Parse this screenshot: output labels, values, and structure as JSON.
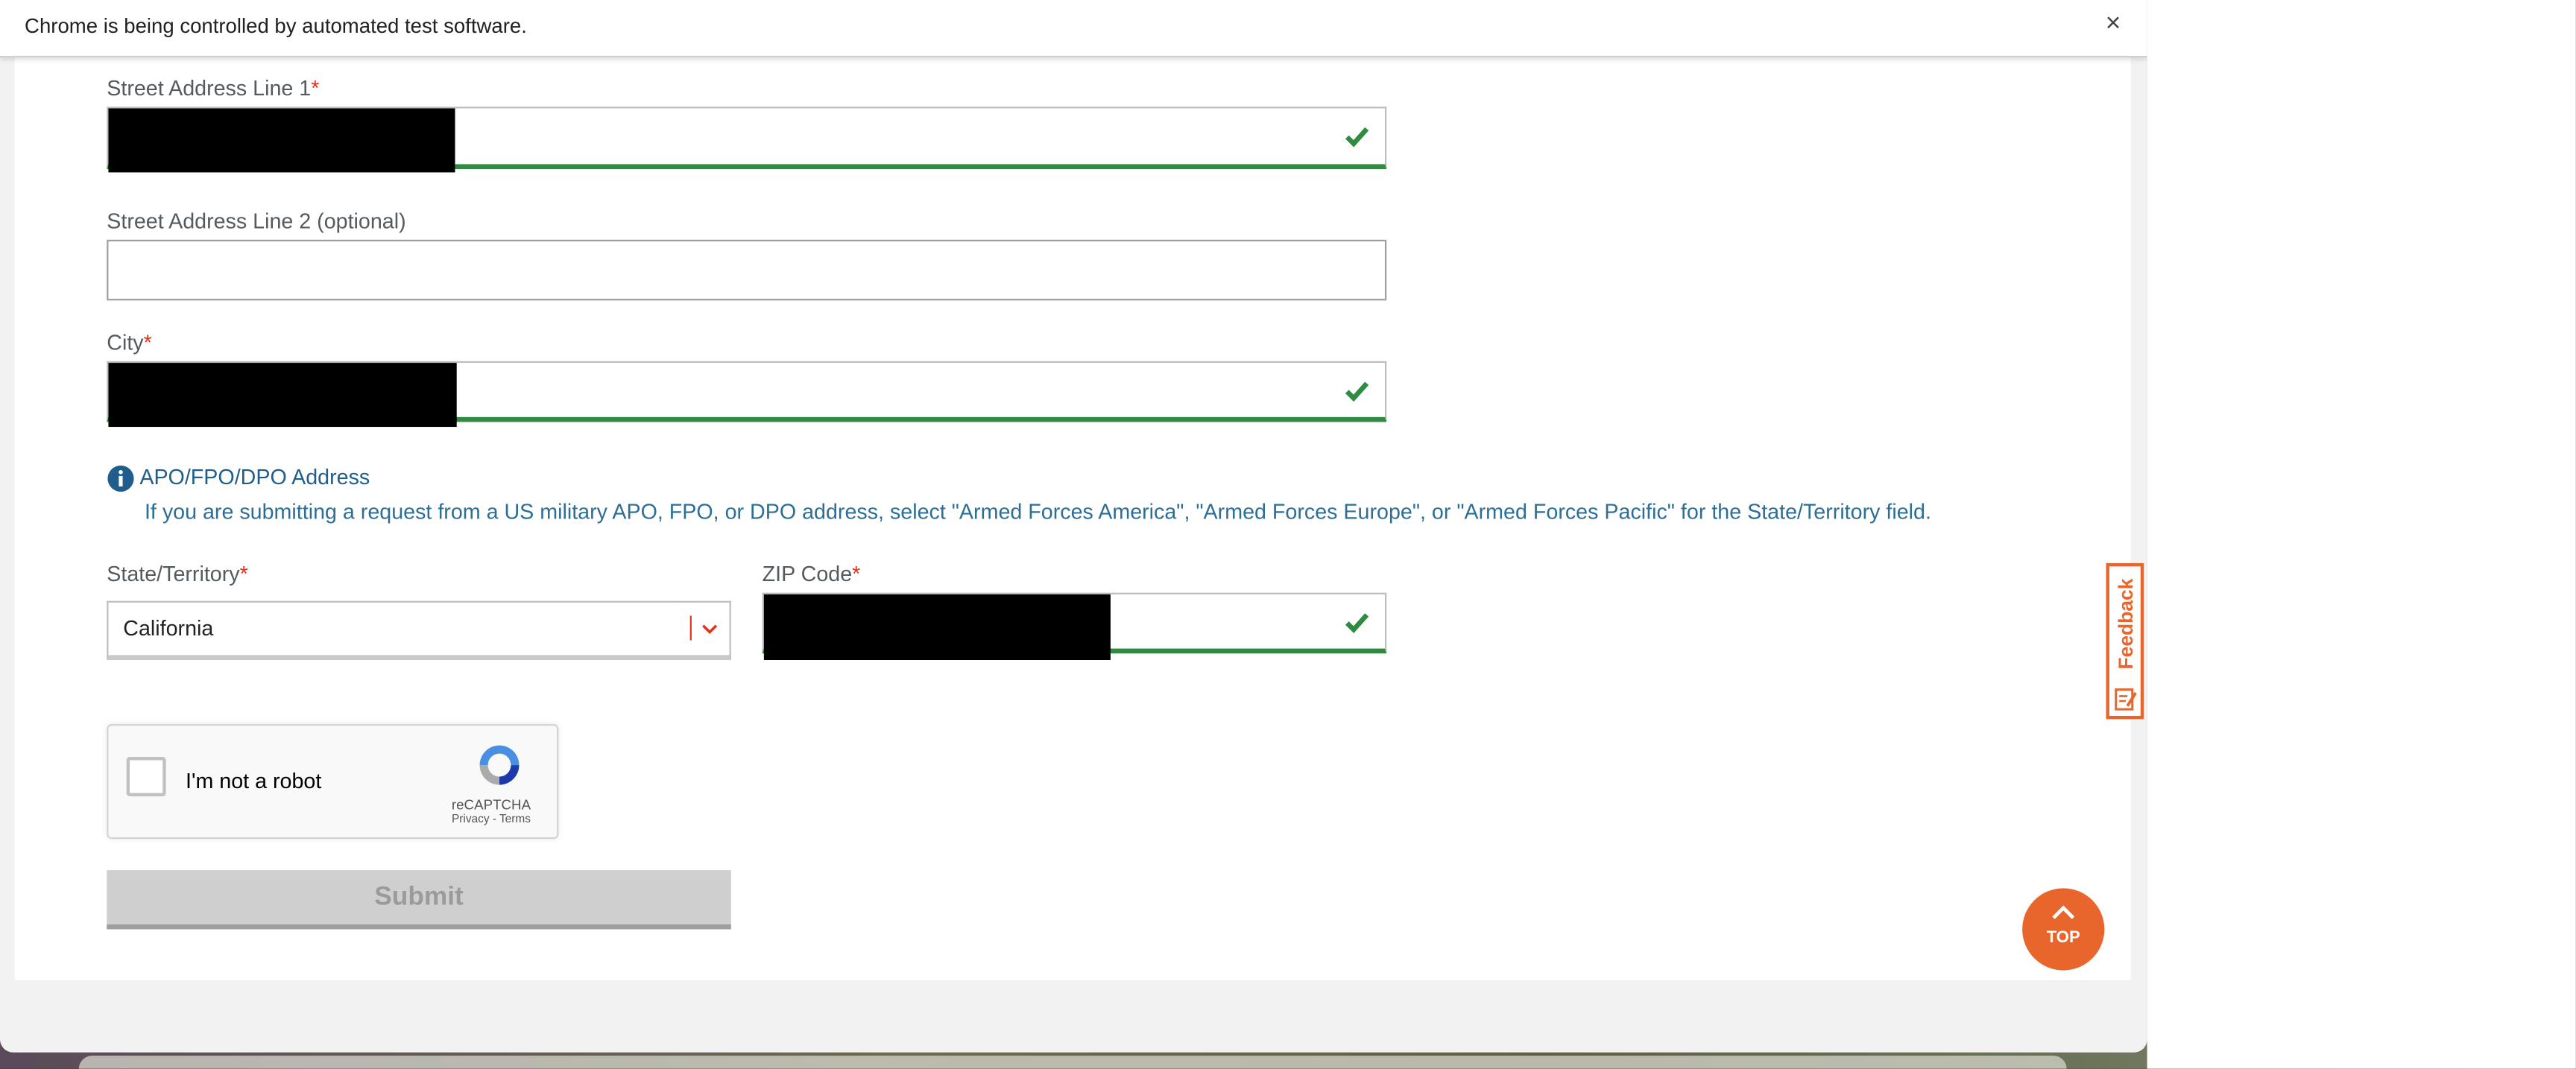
{
  "infobar": {
    "message": "Chrome is being controlled by automated test software.",
    "close_symbol": "×"
  },
  "form": {
    "street1": {
      "label": "Street Address Line 1",
      "required_mark": "*",
      "value_redacted": true,
      "valid": true
    },
    "street2": {
      "label": "Street Address Line 2 (optional)",
      "value": ""
    },
    "city": {
      "label": "City",
      "required_mark": "*",
      "value_redacted": true,
      "valid": true
    },
    "apo_notice": {
      "title": "APO/FPO/DPO Address",
      "text": "If you are submitting a request from a US military APO, FPO, or DPO address, select \"Armed Forces America\", \"Armed Forces Europe\", or \"Armed Forces Pacific\" for the State/Territory field.",
      "icon": "info-icon"
    },
    "state": {
      "label": "State/Territory",
      "required_mark": "*",
      "selected": "California",
      "icon": "chevron-down-icon"
    },
    "zip": {
      "label": "ZIP Code",
      "required_mark": "*",
      "value_redacted": true,
      "valid": true
    },
    "captcha": {
      "label": "I'm not a robot",
      "brand": "reCAPTCHA",
      "links": "Privacy - Terms",
      "checked": false
    },
    "submit_label": "Submit",
    "submit_enabled": false
  },
  "feedback_tab": {
    "label": "Feedback",
    "icon": "feedback-icon"
  },
  "top_button": {
    "label": "TOP",
    "icon": "chevron-up-icon"
  },
  "colors": {
    "valid": "#2e8b3f",
    "required": "#e0331b",
    "accent": "#e8662c",
    "info": "#1f5e8c"
  }
}
